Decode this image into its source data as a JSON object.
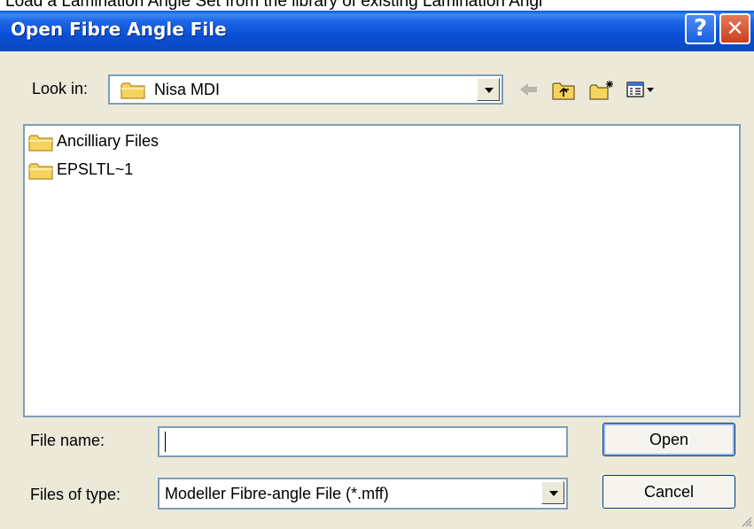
{
  "top_caption": "Load a Lamination Angle Set from the library of existing Lamination Angl",
  "dialog": {
    "title": "Open Fibre Angle File",
    "help_glyph": "?",
    "close_glyph": "✕"
  },
  "lookin": {
    "label": "Look in:",
    "value": "Nisa MDI"
  },
  "toolbar": {
    "icons": [
      "back-arrow-icon",
      "up-one-level-icon",
      "new-folder-icon",
      "view-menu-icon"
    ]
  },
  "files": [
    {
      "name": "Ancilliary Files",
      "icon": "folder-icon"
    },
    {
      "name": "EPSLTL~1",
      "icon": "folder-icon"
    }
  ],
  "filename": {
    "label": "File name:",
    "value": ""
  },
  "filetype": {
    "label": "Files of type:",
    "value": "Modeller Fibre-angle File (*.mff)"
  },
  "buttons": {
    "open": "Open",
    "cancel": "Cancel"
  },
  "colors": {
    "titlebar": "#0a50d6",
    "dialog_bg": "#ece9d8",
    "field_border": "#7f9db9",
    "folder": "#f6d35e"
  }
}
